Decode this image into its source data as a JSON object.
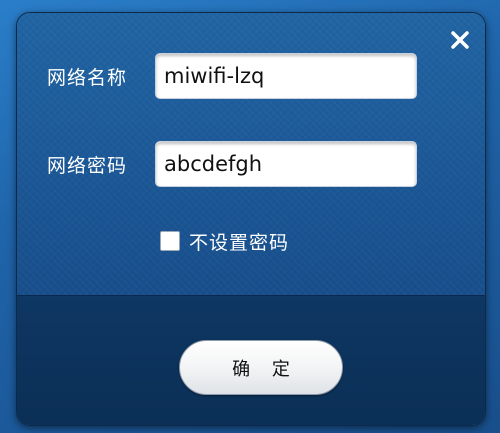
{
  "dialog": {
    "close_icon": "close-icon",
    "network_name_label": "网络名称",
    "network_name_value": "miwifi-lzq",
    "network_password_label": "网络密码",
    "network_password_value": "abcdefgh",
    "no_password_checkbox_label": "不设置密码",
    "no_password_checked": false,
    "confirm_button_label": "确 定"
  },
  "colors": {
    "dialog_background": "#1c5897",
    "dialog_footer": "#0d3460",
    "text": "#ffffff",
    "button_background": "#f3f4f5"
  }
}
